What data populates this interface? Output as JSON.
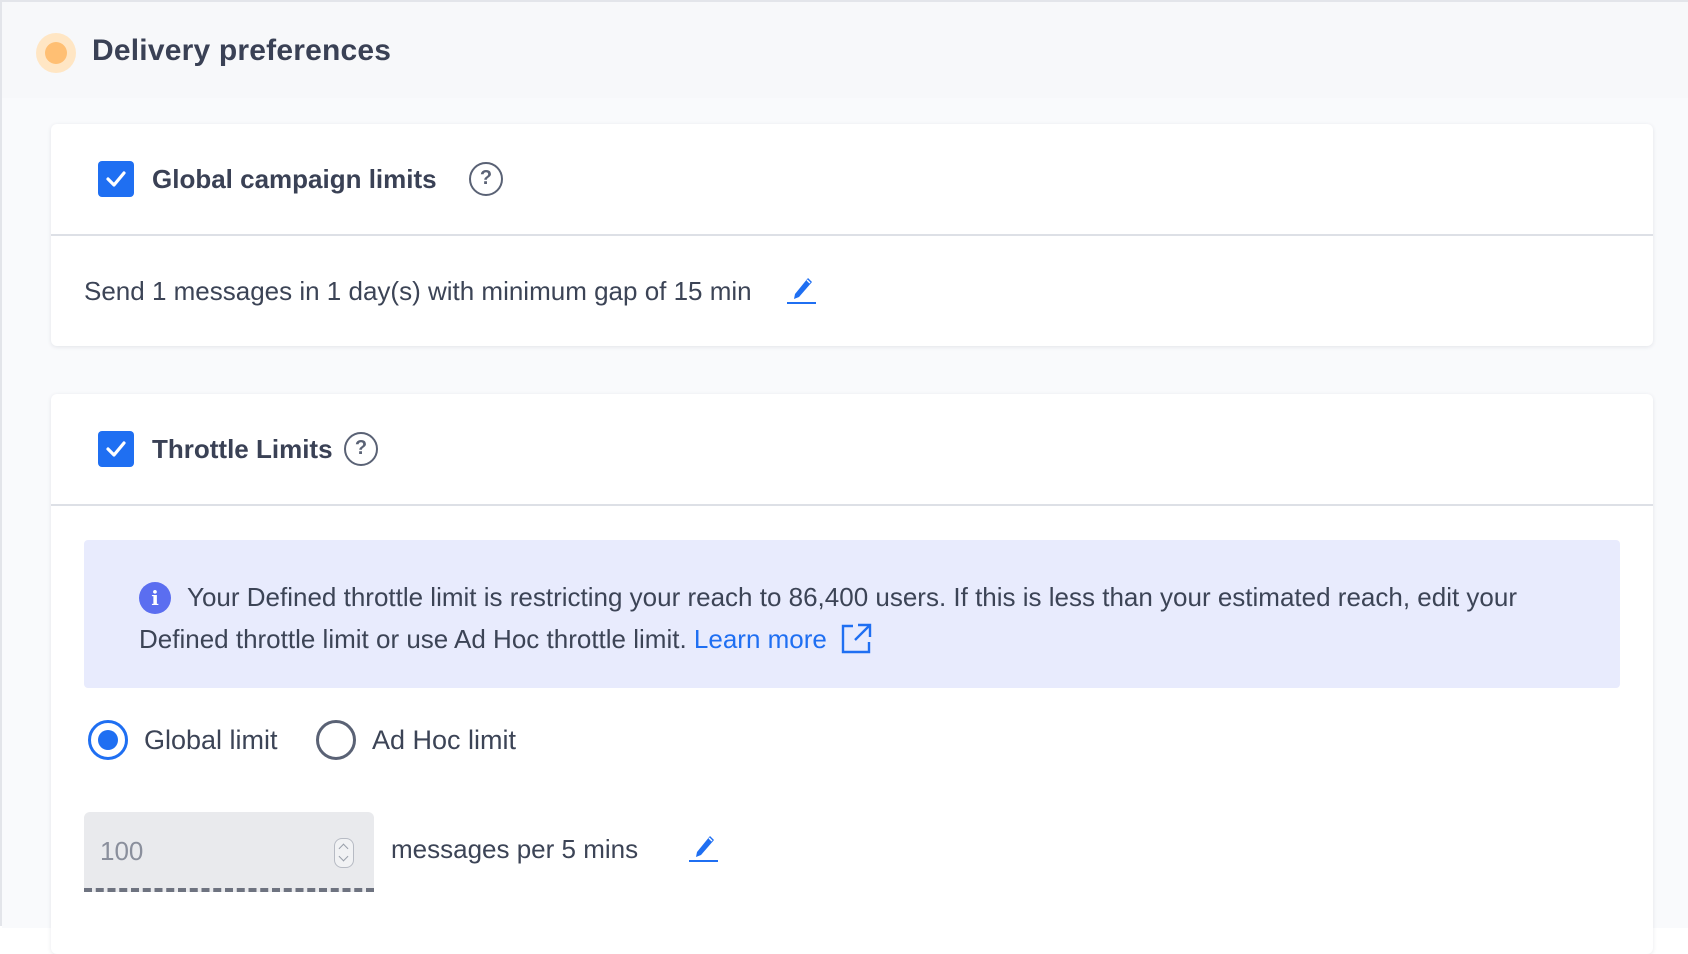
{
  "panel": {
    "title": "Delivery preferences",
    "status_color": "#ffbf73"
  },
  "global_card": {
    "checked": true,
    "title": "Global campaign limits",
    "help_icon": "?",
    "rule_text": "Send 1 messages in 1 day(s) with minimum gap of 15 min",
    "edit_icon": "pencil-icon"
  },
  "throttle_card": {
    "checked": true,
    "title": "Throttle Limits",
    "help_icon": "?",
    "info": {
      "icon": "i",
      "text": "Your Defined throttle limit is restricting your reach to 86,400 users. If this is less than your estimated reach, edit your Defined throttle limit or use Ad Hoc throttle limit.",
      "link": "Learn more",
      "link_icon": "external-link-icon"
    },
    "options": [
      {
        "label": "Global limit",
        "selected": true
      },
      {
        "label": "Ad Hoc limit",
        "selected": false
      }
    ],
    "limit_value": "100",
    "limit_unit": "messages per 5 mins"
  },
  "colors": {
    "accent": "#1f6ff2",
    "info_bg": "#e8ebfd",
    "info_icon": "#5b6ef0",
    "text": "#3c4456"
  }
}
